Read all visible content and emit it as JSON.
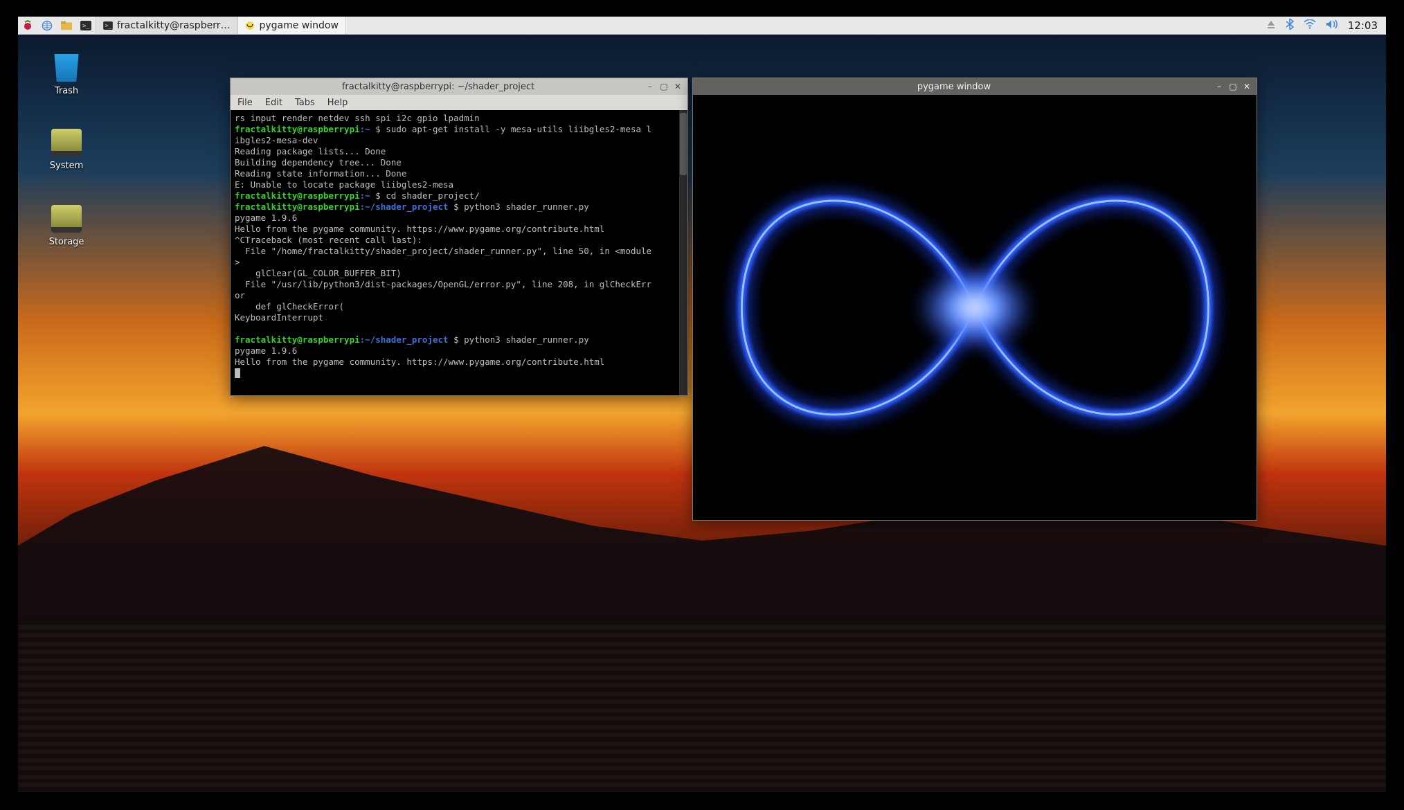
{
  "taskbar": {
    "tasks": [
      {
        "label": "fractalkitty@raspberr…",
        "icon": "terminal"
      },
      {
        "label": "pygame window",
        "icon": "pygame"
      }
    ],
    "clock": "12:03"
  },
  "desktop_icons": [
    {
      "name": "Trash"
    },
    {
      "name": "System"
    },
    {
      "name": "Storage"
    }
  ],
  "terminal": {
    "title": "fractalkitty@raspberrypi: ~/shader_project",
    "menus": [
      "File",
      "Edit",
      "Tabs",
      "Help"
    ],
    "prompt_user": "fractalkitty@raspberrypi",
    "prompt_home": ":~",
    "prompt_path": ":~/shader_project",
    "prompt_sym": " $ ",
    "lines": {
      "l0": "rs input render netdev ssh spi i2c gpio lpadmin",
      "cmd1": "sudo apt-get install -y mesa-utils liibgles2-mesa l",
      "l2": "ibgles2-mesa-dev",
      "l3": "Reading package lists... Done",
      "l4": "Building dependency tree... Done",
      "l5": "Reading state information... Done",
      "l6": "E: Unable to locate package liibgles2-mesa",
      "cmd2": "cd shader_project/",
      "cmd3": "python3 shader_runner.py",
      "l8": "pygame 1.9.6",
      "l9": "Hello from the pygame community. https://www.pygame.org/contribute.html",
      "l10": "^CTraceback (most recent call last):",
      "l11": "  File \"/home/fractalkitty/shader_project/shader_runner.py\", line 50, in <module",
      "l12": ">",
      "l13": "    glClear(GL_COLOR_BUFFER_BIT)",
      "l14": "  File \"/usr/lib/python3/dist-packages/OpenGL/error.py\", line 208, in glCheckErr",
      "l15": "or",
      "l16": "    def glCheckError(",
      "l17": "KeyboardInterrupt",
      "l18": "",
      "cmd4": "python3 shader_runner.py",
      "l19": "pygame 1.9.6",
      "l20": "Hello from the pygame community. https://www.pygame.org/contribute.html"
    }
  },
  "pygame": {
    "title": "pygame window"
  }
}
